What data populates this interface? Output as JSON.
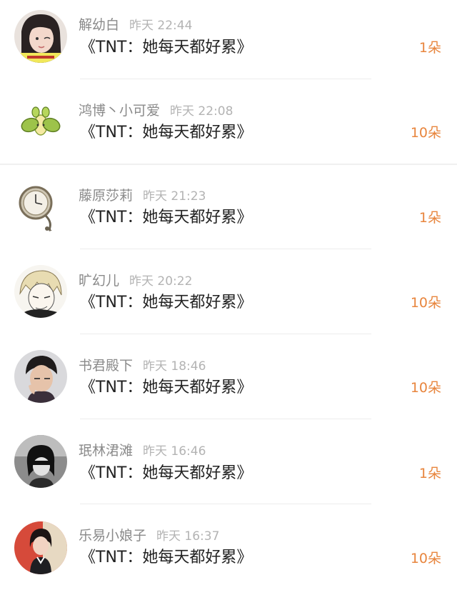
{
  "items": [
    {
      "name": "解幼白",
      "time": "昨天 22:44",
      "song": "《TNT：她每天都好累》",
      "count": "1朵",
      "avatar": "girl-photo-avatar"
    },
    {
      "name": "鸿博丶小可爱",
      "time": "昨天 22:08",
      "song": "《TNT：她每天都好累》",
      "count": "10朵",
      "avatar": "leaf-sprout-avatar"
    },
    {
      "name": "藤原莎莉",
      "time": "昨天 21:23",
      "song": "《TNT：她每天都好累》",
      "count": "1朵",
      "avatar": "pocket-watch-avatar"
    },
    {
      "name": "旷幻儿",
      "time": "昨天 20:22",
      "song": "《TNT：她每天都好累》",
      "count": "10朵",
      "avatar": "anime-sketch-avatar"
    },
    {
      "name": "书君殿下",
      "time": "昨天 18:46",
      "song": "《TNT：她每天都好累》",
      "count": "10朵",
      "avatar": "boy-photo-avatar"
    },
    {
      "name": "珉林涒滩",
      "time": "昨天 16:46",
      "song": "《TNT：她每天都好累》",
      "count": "1朵",
      "avatar": "bw-portrait-avatar"
    },
    {
      "name": "乐易小娘子",
      "time": "昨天 16:37",
      "song": "《TNT：她每天都好累》",
      "count": "10朵",
      "avatar": "girl-red-background-avatar"
    }
  ],
  "colors": {
    "name": "#8a8a8a",
    "time": "#b3b3b3",
    "song": "#222222",
    "count": "#e8853d",
    "divider": "#ececec"
  }
}
